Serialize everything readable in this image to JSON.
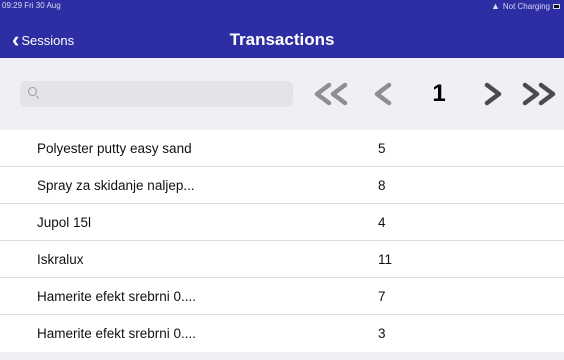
{
  "status_bar": {
    "time": "09:29  Fri 30 Aug",
    "charging": "Not Charging"
  },
  "navbar": {
    "back_label": "Sessions",
    "title": "Transactions"
  },
  "search": {
    "placeholder": "",
    "value": ""
  },
  "pager": {
    "current_page": "1",
    "icons": [
      "double-left-chevron",
      "left-chevron",
      "right-chevron",
      "double-right-chevron"
    ]
  },
  "colors": {
    "navbar": "#2d2ea3",
    "pager_left": "#8e8e93",
    "pager_right": "#4a4a4f",
    "background": "#efeff4"
  },
  "transactions": [
    {
      "name": "Polyester putty easy sand",
      "qty": "5"
    },
    {
      "name": "Spray za skidanje naljep...",
      "qty": "8"
    },
    {
      "name": "Jupol 15l",
      "qty": "4"
    },
    {
      "name": "Iskralux",
      "qty": "11"
    },
    {
      "name": "Hamerite efekt srebrni 0....",
      "qty": "7"
    },
    {
      "name": "Hamerite efekt srebrni 0....",
      "qty": "3"
    }
  ]
}
